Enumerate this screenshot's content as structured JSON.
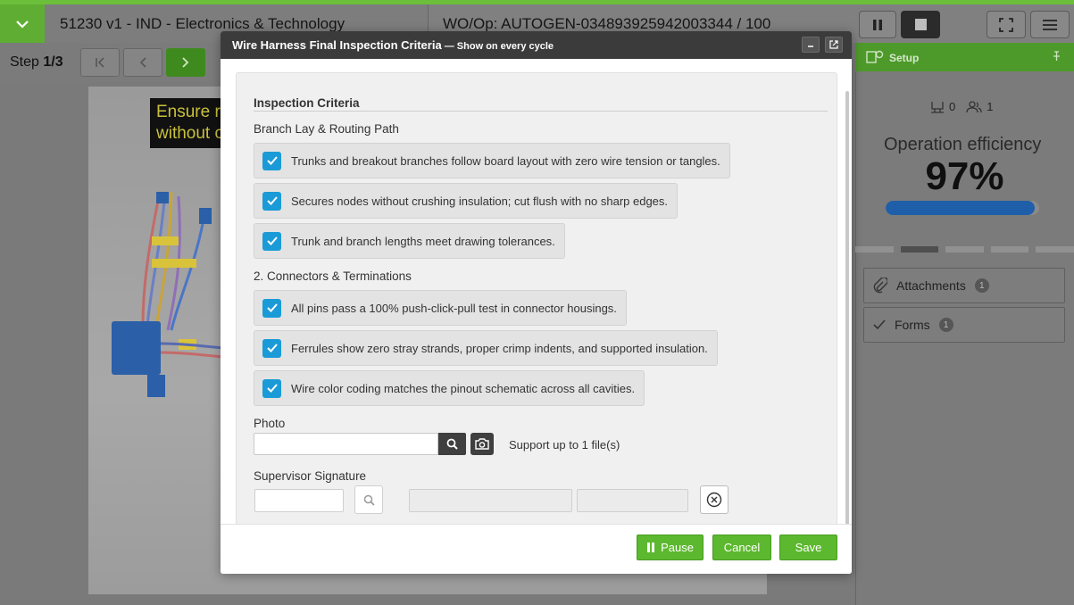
{
  "header": {
    "title": "51230 v1 - IND - Electronics & Technology",
    "work_order": "WO/Op:  AUTOGEN-034893925942003344 / 100"
  },
  "step": {
    "prefix": "Step",
    "value": "1/3"
  },
  "work_image": {
    "banner_line1": "Ensure r",
    "banner_line2": "without c"
  },
  "right_panel": {
    "setup_label": "Setup",
    "count_a": "0",
    "count_b": "1",
    "efficiency_label": "Operation efficiency",
    "efficiency_value": "97%",
    "efficiency_fraction": 0.97,
    "attachments_label": "Attachments",
    "attachments_count": "1",
    "forms_label": "Forms",
    "forms_count": "1"
  },
  "modal": {
    "title": "Wire Harness Final Inspection Criteria",
    "subtitle": " — Show on every cycle",
    "section_title": "Inspection Criteria",
    "group1_title": "Branch Lay & Routing Path",
    "group1_items": [
      "Trunks and breakout branches follow board layout with zero wire tension or tangles.",
      "Secures nodes without crushing insulation; cut flush with no sharp edges.",
      "Trunk and branch lengths meet drawing tolerances."
    ],
    "group2_title": "2. Connectors & Terminations",
    "group2_items": [
      "All pins pass a 100% push-click-pull test in connector housings.",
      "Ferrules show zero stray strands, proper crimp indents, and supported insulation.",
      "Wire color coding matches the pinout schematic across all cavities."
    ],
    "photo_label": "Photo",
    "photo_support": "Support up to 1 file(s)",
    "signature_label": "Supervisor Signature",
    "buttons": {
      "pause": "Pause",
      "cancel": "Cancel",
      "save": "Save"
    }
  },
  "colors": {
    "accent_green": "#5cb82e",
    "checkbox_blue": "#1a9bd7",
    "progress_blue": "#1f5fa9",
    "header_dark": "#3b3b3b"
  }
}
